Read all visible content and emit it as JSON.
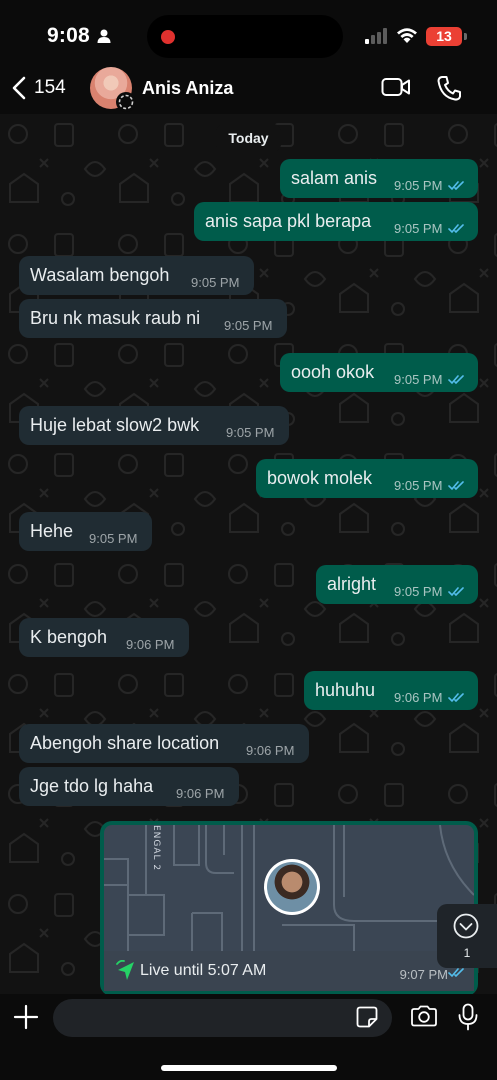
{
  "status_bar": {
    "time": "9:08",
    "battery": "13"
  },
  "header": {
    "back_count": "154",
    "contact_name": "Anis Aniza"
  },
  "chat": {
    "day_label": "Today",
    "messages": [
      {
        "dir": "out",
        "text": "salam anis",
        "time": "9:05 PM"
      },
      {
        "dir": "out",
        "text": "anis sapa pkl berapa",
        "time": "9:05 PM"
      },
      {
        "dir": "in",
        "text": "Wasalam bengoh",
        "time": "9:05 PM"
      },
      {
        "dir": "in",
        "text": "Bru nk masuk raub ni",
        "time": "9:05 PM"
      },
      {
        "dir": "out",
        "text": "oooh okok",
        "time": "9:05 PM"
      },
      {
        "dir": "in",
        "text": "Huje lebat slow2 bwk",
        "time": "9:05 PM"
      },
      {
        "dir": "out",
        "text": "bowok molek",
        "time": "9:05 PM"
      },
      {
        "dir": "in",
        "text": "Hehe",
        "time": "9:05 PM"
      },
      {
        "dir": "out",
        "text": "alright",
        "time": "9:05 PM"
      },
      {
        "dir": "in",
        "text": "K bengoh",
        "time": "9:06 PM"
      },
      {
        "dir": "out",
        "text": "huhuhu",
        "time": "9:06 PM"
      },
      {
        "dir": "in",
        "text": "Abengoh share location",
        "time": "9:06 PM"
      },
      {
        "dir": "in",
        "text": "Jge tdo lg haha",
        "time": "9:06 PM"
      }
    ],
    "live_location": {
      "map_street_label": "ENGAL 2",
      "label": "Live until 5:07 AM",
      "time": "9:07 PM"
    },
    "unread_count": "1"
  },
  "colors": {
    "incoming_bubble": "#202c33",
    "outgoing_bubble": "#005c4b",
    "read_ticks": "#53bdeb",
    "chat_background": "#121212"
  },
  "icons": [
    "person-icon",
    "signal-icon",
    "wifi-icon",
    "back-chevron-icon",
    "video-call-icon",
    "phone-call-icon",
    "double-tick-icon",
    "live-location-icon",
    "chevron-down-icon",
    "plus-icon",
    "sticker-icon",
    "camera-icon",
    "microphone-icon"
  ]
}
